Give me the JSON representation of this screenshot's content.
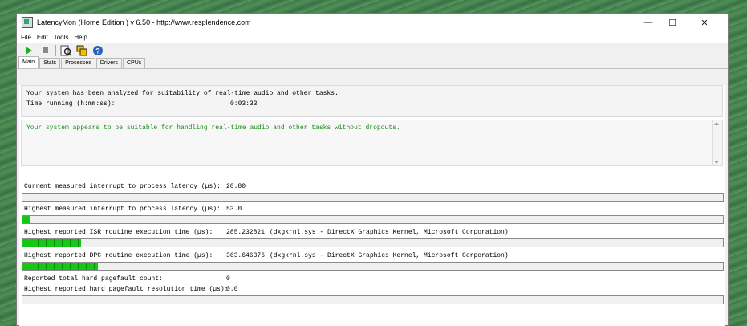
{
  "window": {
    "title": "LatencyMon  (Home Edition )  v 6.50 - http://www.resplendence.com",
    "minimize": "—",
    "maximize": "☐",
    "close": "✕"
  },
  "menu": {
    "file": "File",
    "edit": "Edit",
    "tools": "Tools",
    "help": "Help"
  },
  "toolbar": {
    "play_icon": "play-icon",
    "stop_icon": "stop-icon",
    "help_glyph": "?"
  },
  "tabs": [
    "Main",
    "Stats",
    "Processes",
    "Drivers",
    "CPUs"
  ],
  "summary": {
    "analyzed": "Your system has been analyzed for suitability of real-time audio and other tasks.",
    "time_label": "Time running (h:mm:ss):",
    "time_value": "0:03:33",
    "verdict": "Your system appears to be suitable for handling real-time audio and other tasks without dropouts.",
    "verdict_color": "#1a8c1a"
  },
  "metrics": {
    "current_label": "Current measured interrupt to process latency (µs):",
    "current_value": "20.80",
    "current_fill": 0.0,
    "highest_label": "Highest measured interrupt to process latency (µs):",
    "highest_value": "53.0",
    "highest_fill": 0.012,
    "isr_label": "Highest reported ISR routine execution time (µs):",
    "isr_value": "285.232821",
    "isr_driver": "(dxgkrnl.sys - DirectX Graphics Kernel, Microsoft Corporation)",
    "isr_fill": 0.084,
    "dpc_label": "Highest reported DPC routine execution time (µs):",
    "dpc_value": "363.646376",
    "dpc_driver": "(dxgkrnl.sys - DirectX Graphics Kernel, Microsoft Corporation)",
    "dpc_fill": 0.108,
    "pagefault_count_label": "Reported total hard pagefault count:",
    "pagefault_count_value": "0",
    "pagefault_res_label": "Highest reported hard pagefault resolution time (µs):",
    "pagefault_res_value": "0.0",
    "pagefault_fill": 0.0
  }
}
